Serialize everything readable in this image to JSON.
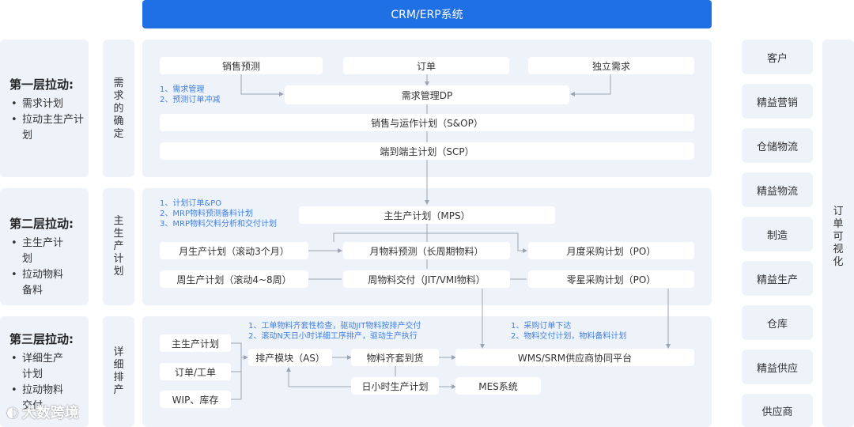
{
  "header": {
    "title": "CRM/ERP系统"
  },
  "layers": [
    {
      "title": "第一层拉动:",
      "items": [
        "需求计划",
        "拉动主生产计划"
      ]
    },
    {
      "title": "第二层拉动:",
      "items": [
        "主生产计划",
        "拉动物料备料"
      ]
    },
    {
      "title": "第三层拉动:",
      "items": [
        "详细生产计划",
        "拉动物料交付"
      ]
    }
  ],
  "sections": [
    "需求的确定",
    "主生产计划",
    "详细排产"
  ],
  "section1": {
    "sales_forecast": "销售预测",
    "orders": "订单",
    "independent_demand": "独立需求",
    "demand_mgmt": "需求管理DP",
    "sop": "销售与运作计划（S&OP）",
    "scp": "端到端主计划（SCP）",
    "notes": [
      "1、需求管理",
      "2、预测订单冲减"
    ]
  },
  "section2": {
    "mps": "主生产计划（MPS）",
    "monthly_prod": "月生产计划（滚动3个月）",
    "monthly_material_forecast": "月物料预测（长周期物料）",
    "monthly_po": "月度采购计划（PO）",
    "weekly_prod": "周生产计划（滚动4~8周）",
    "weekly_delivery": "周物料交付（JIT/VMI物料）",
    "sporadic_po": "零星采购计划（PO）",
    "notes": [
      "1、计划订单&PO",
      "2、MRP物料预测备料计划",
      "3、MRP物料欠料分析和交付计划"
    ]
  },
  "section3": {
    "mps": "主生产计划",
    "orders": "订单/工单",
    "wip": "WIP、库存",
    "as": "排产模块（AS）",
    "kitting": "物料齐套到货",
    "hourly_plan": "日小时生产计划",
    "mes": "MES系统",
    "wms_srm": "WMS/SRM供应商协同平台",
    "notes_left": [
      "1、工单物料齐套性检查，驱动JIT物料按排产交付",
      "2、滚动N天日小时详细工序排产，驱动生产执行"
    ],
    "notes_right": [
      "1、采购订单下达",
      "2、物料交付计划，物料备料计划"
    ]
  },
  "right_column": [
    "客户",
    "精益营销",
    "仓储物流",
    "精益物流",
    "制造",
    "精益生产",
    "仓库",
    "精益供应",
    "供应商"
  ],
  "right_label": "订单可视化",
  "watermark": "大数跨境",
  "colors": {
    "primary": "#1f6fe5",
    "panel": "#eef3fa",
    "note": "#3f7fe0"
  }
}
